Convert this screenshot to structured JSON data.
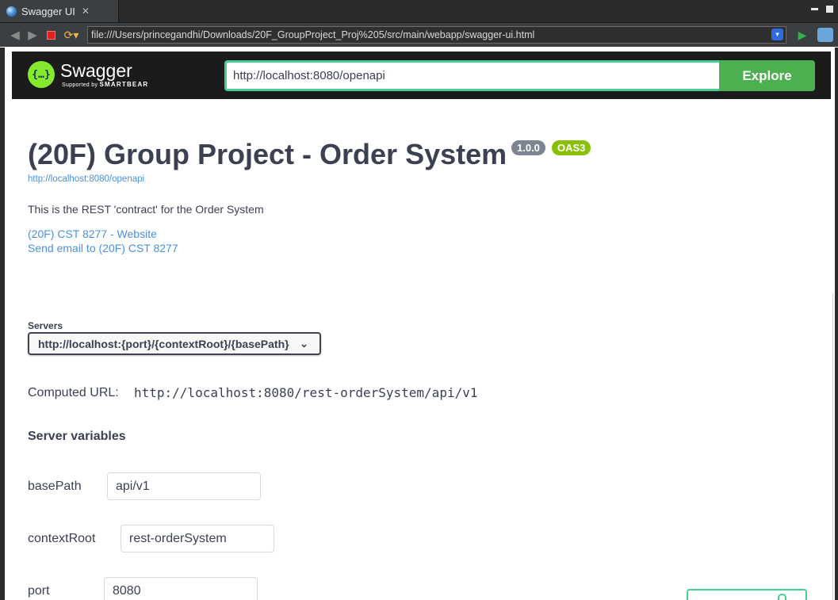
{
  "editor_tab": {
    "title": "Swagger UI",
    "close_symbol": "✕"
  },
  "browser": {
    "url": "file:///Users/princegandhi/Downloads/20F_GroupProject_Proj%205/src/main/webapp/swagger-ui.html"
  },
  "topbar": {
    "logo_name": "Swagger",
    "logo_symbol": "{…}",
    "logo_supported_by": "Supported by",
    "logo_company": "SMARTBEAR",
    "api_url": "http://localhost:8080/openapi",
    "explore_label": "Explore"
  },
  "info": {
    "title": "(20F) Group Project - Order System",
    "version": "1.0.0",
    "oas_badge": "OAS3",
    "spec_url": "http://localhost:8080/openapi",
    "description": "This is the REST 'contract' for the Order System",
    "website_link": "(20F) CST 8277 - Website",
    "email_link": "Send email to (20F) CST 8277"
  },
  "servers": {
    "label": "Servers",
    "selected": "http://localhost:{port}/{contextRoot}/{basePath}",
    "computed_url_label": "Computed URL:",
    "computed_url": "http://localhost:8080/rest-orderSystem/api/v1",
    "variables_heading": "Server variables",
    "variables": [
      {
        "name": "basePath",
        "value": "api/v1"
      },
      {
        "name": "contextRoot",
        "value": "rest-orderSystem"
      },
      {
        "name": "port",
        "value": "8080"
      }
    ]
  },
  "colors": {
    "swagger_green": "#85ea2d",
    "explore_green": "#4caf50",
    "url_border": "#49cc90",
    "link_blue": "#4990e2",
    "text_dark": "#3b4151",
    "version_badge": "#7d8492",
    "oas_badge": "#89bf04"
  }
}
